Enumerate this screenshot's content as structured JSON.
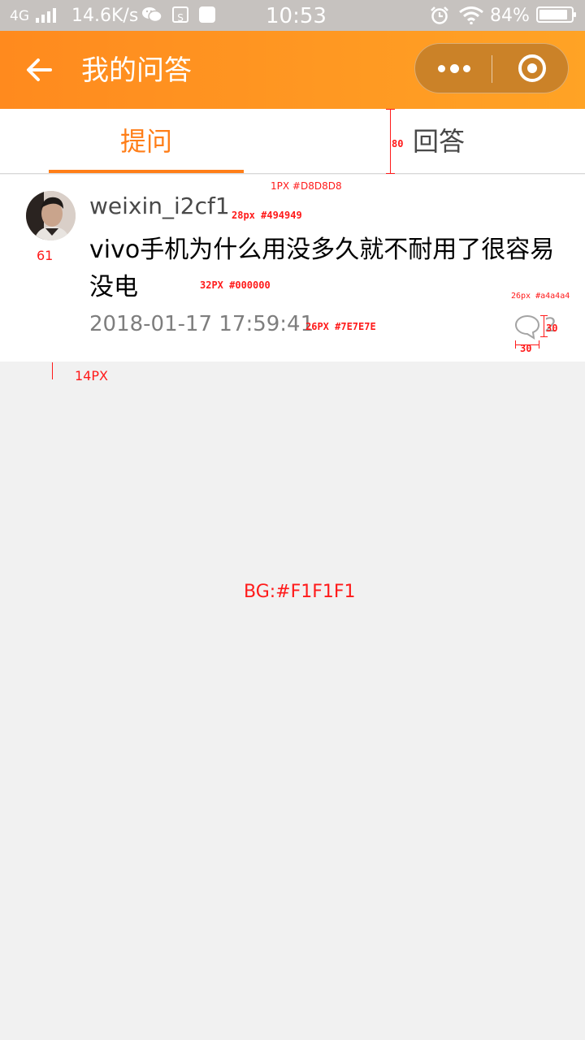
{
  "status_bar": {
    "network": "4G",
    "speed": "14.6K/s",
    "box_icon_text": "S",
    "time": "10:53",
    "battery": "84%"
  },
  "header": {
    "title": "我的问答",
    "icons": [
      "back-arrow-icon",
      "more-dots-icon",
      "close-circle-icon"
    ],
    "background_colors": [
      "#FF8A1E",
      "#FFA325"
    ]
  },
  "tabs": [
    {
      "label": "提问",
      "active": true,
      "color": "#FF7E18"
    },
    {
      "label": "回答",
      "active": false,
      "color": "#494949"
    }
  ],
  "question": {
    "username": "weixin_i2cf1",
    "text": "vivo手机为什么用没多久就不耐用了很容易没电",
    "date": "2018-01-17 17:59:41",
    "comment_count": "2",
    "comment_icon": "comment-bubble-icon"
  },
  "annotations": {
    "tab_height": "80",
    "divider": "1PX #D8D8D8",
    "username_spec": "28px #494949",
    "avatar_size": "61",
    "question_spec": "32PX #000000",
    "comment_spec": "26px #a4a4a4",
    "icon_height": "30",
    "date_spec": "26PX #7E7E7E",
    "icon_width": "30",
    "gap": "14PX",
    "background": "BG:#F1F1F1"
  },
  "colors": {
    "background": "#F1F1F1",
    "accent": "#FF7E18",
    "divider": "#D8D8D8",
    "username": "#494949",
    "question": "#000000",
    "date": "#7E7E7E",
    "comment": "#a4a4a4",
    "annotation": "#FF1A1A"
  }
}
